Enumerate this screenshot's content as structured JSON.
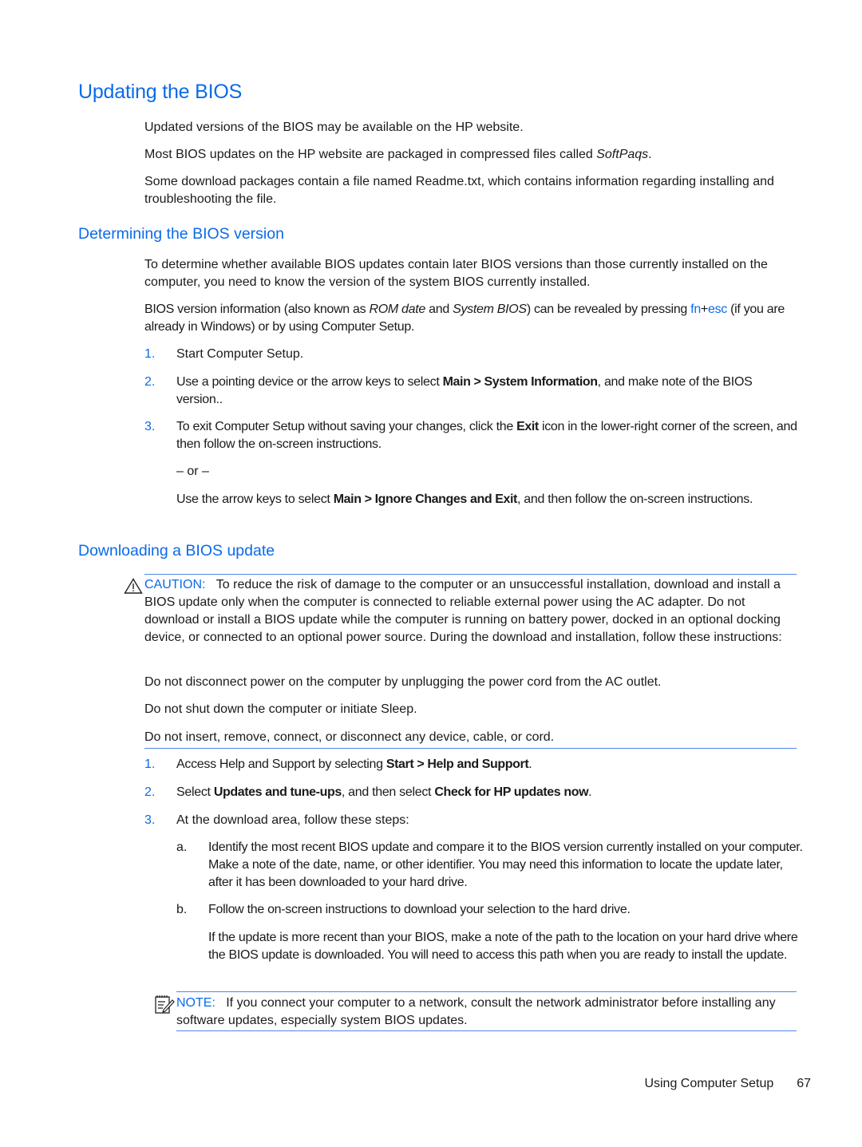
{
  "sections": {
    "updating": {
      "title": "Updating the BIOS",
      "p1": "Updated versions of the BIOS may be available on the HP website.",
      "p2_pre": "Most BIOS updates on the HP website are packaged in compressed files called ",
      "p2_em": "SoftPaqs",
      "p2_post": ".",
      "p3": "Some download packages contain a file named Readme.txt, which contains information regarding installing and troubleshooting the file."
    },
    "determining": {
      "title": "Determining the BIOS version",
      "p1": "To determine whether available BIOS updates contain later BIOS versions than those currently installed on the computer, you need to know the version of the system BIOS currently installed.",
      "p2_a": "BIOS version information (also known as ",
      "p2_em1": "ROM date",
      "p2_b": " and ",
      "p2_em2": "System BIOS",
      "p2_c": ") can be revealed by pressing ",
      "key_fn": "fn",
      "key_plus": "+",
      "key_esc": "esc",
      "p2_d": " (if you are already in Windows) or by using Computer Setup.",
      "steps": [
        {
          "num": "1.",
          "text": "Start Computer Setup."
        },
        {
          "num": "2.",
          "pre": "Use a pointing device or the arrow keys to select ",
          "bold": "Main > System Information",
          "post": ", and make note of the BIOS version.."
        },
        {
          "num": "3.",
          "pre": "To exit Computer Setup without saving your changes, click the ",
          "bold": "Exit",
          "post": " icon in the lower-right corner of the screen, and then follow the on-screen instructions."
        }
      ],
      "or": "– or –",
      "alt_pre": "Use the arrow keys to select ",
      "alt_bold": "Main > Ignore Changes and Exit",
      "alt_post": ", and then follow the on-screen instructions."
    },
    "downloading": {
      "title": "Downloading a BIOS update",
      "caution_label": "CAUTION:",
      "caution_text": "To reduce the risk of damage to the computer or an unsuccessful installation, download and install a BIOS update only when the computer is connected to reliable external power using the AC adapter. Do not download or install a BIOS update while the computer is running on battery power, docked in an optional docking device, or connected to an optional power source. During the download and installation, follow these instructions:",
      "caution_items": [
        "Do not disconnect power on the computer by unplugging the power cord from the AC outlet.",
        "Do not shut down the computer or initiate Sleep.",
        "Do not insert, remove, connect, or disconnect any device, cable, or cord."
      ],
      "steps": [
        {
          "num": "1.",
          "pre": "Access Help and Support by selecting ",
          "bold": "Start > Help and Support",
          "post": "."
        },
        {
          "num": "2.",
          "pre": "Select ",
          "bold": "Updates and tune-ups",
          "mid": ", and then select ",
          "bold2": "Check for HP updates now",
          "post": "."
        },
        {
          "num": "3.",
          "text": "At the download area, follow these steps:"
        }
      ],
      "substeps": [
        {
          "label": "a.",
          "text": "Identify the most recent BIOS update and compare it to the BIOS version currently installed on your computer. Make a note of the date, name, or other identifier. You may need this information to locate the update later, after it has been downloaded to your hard drive."
        },
        {
          "label": "b.",
          "text": "Follow the on-screen instructions to download your selection to the hard drive."
        }
      ],
      "substep_b_extra": "If the update is more recent than your BIOS, make a note of the path to the location on your hard drive where the BIOS update is downloaded. You will need to access this path when you are ready to install the update.",
      "note_label": "NOTE:",
      "note_text": "If you connect your computer to a network, consult the network administrator before installing any software updates, especially system BIOS updates."
    }
  },
  "footer": {
    "chapter": "Using Computer Setup",
    "page": "67"
  },
  "icons": {
    "caution": "warning-triangle-icon",
    "note": "note-pencil-icon"
  },
  "colors": {
    "heading": "#0a6be8",
    "rule": "#4f86e8",
    "text": "#1a1a1a"
  }
}
